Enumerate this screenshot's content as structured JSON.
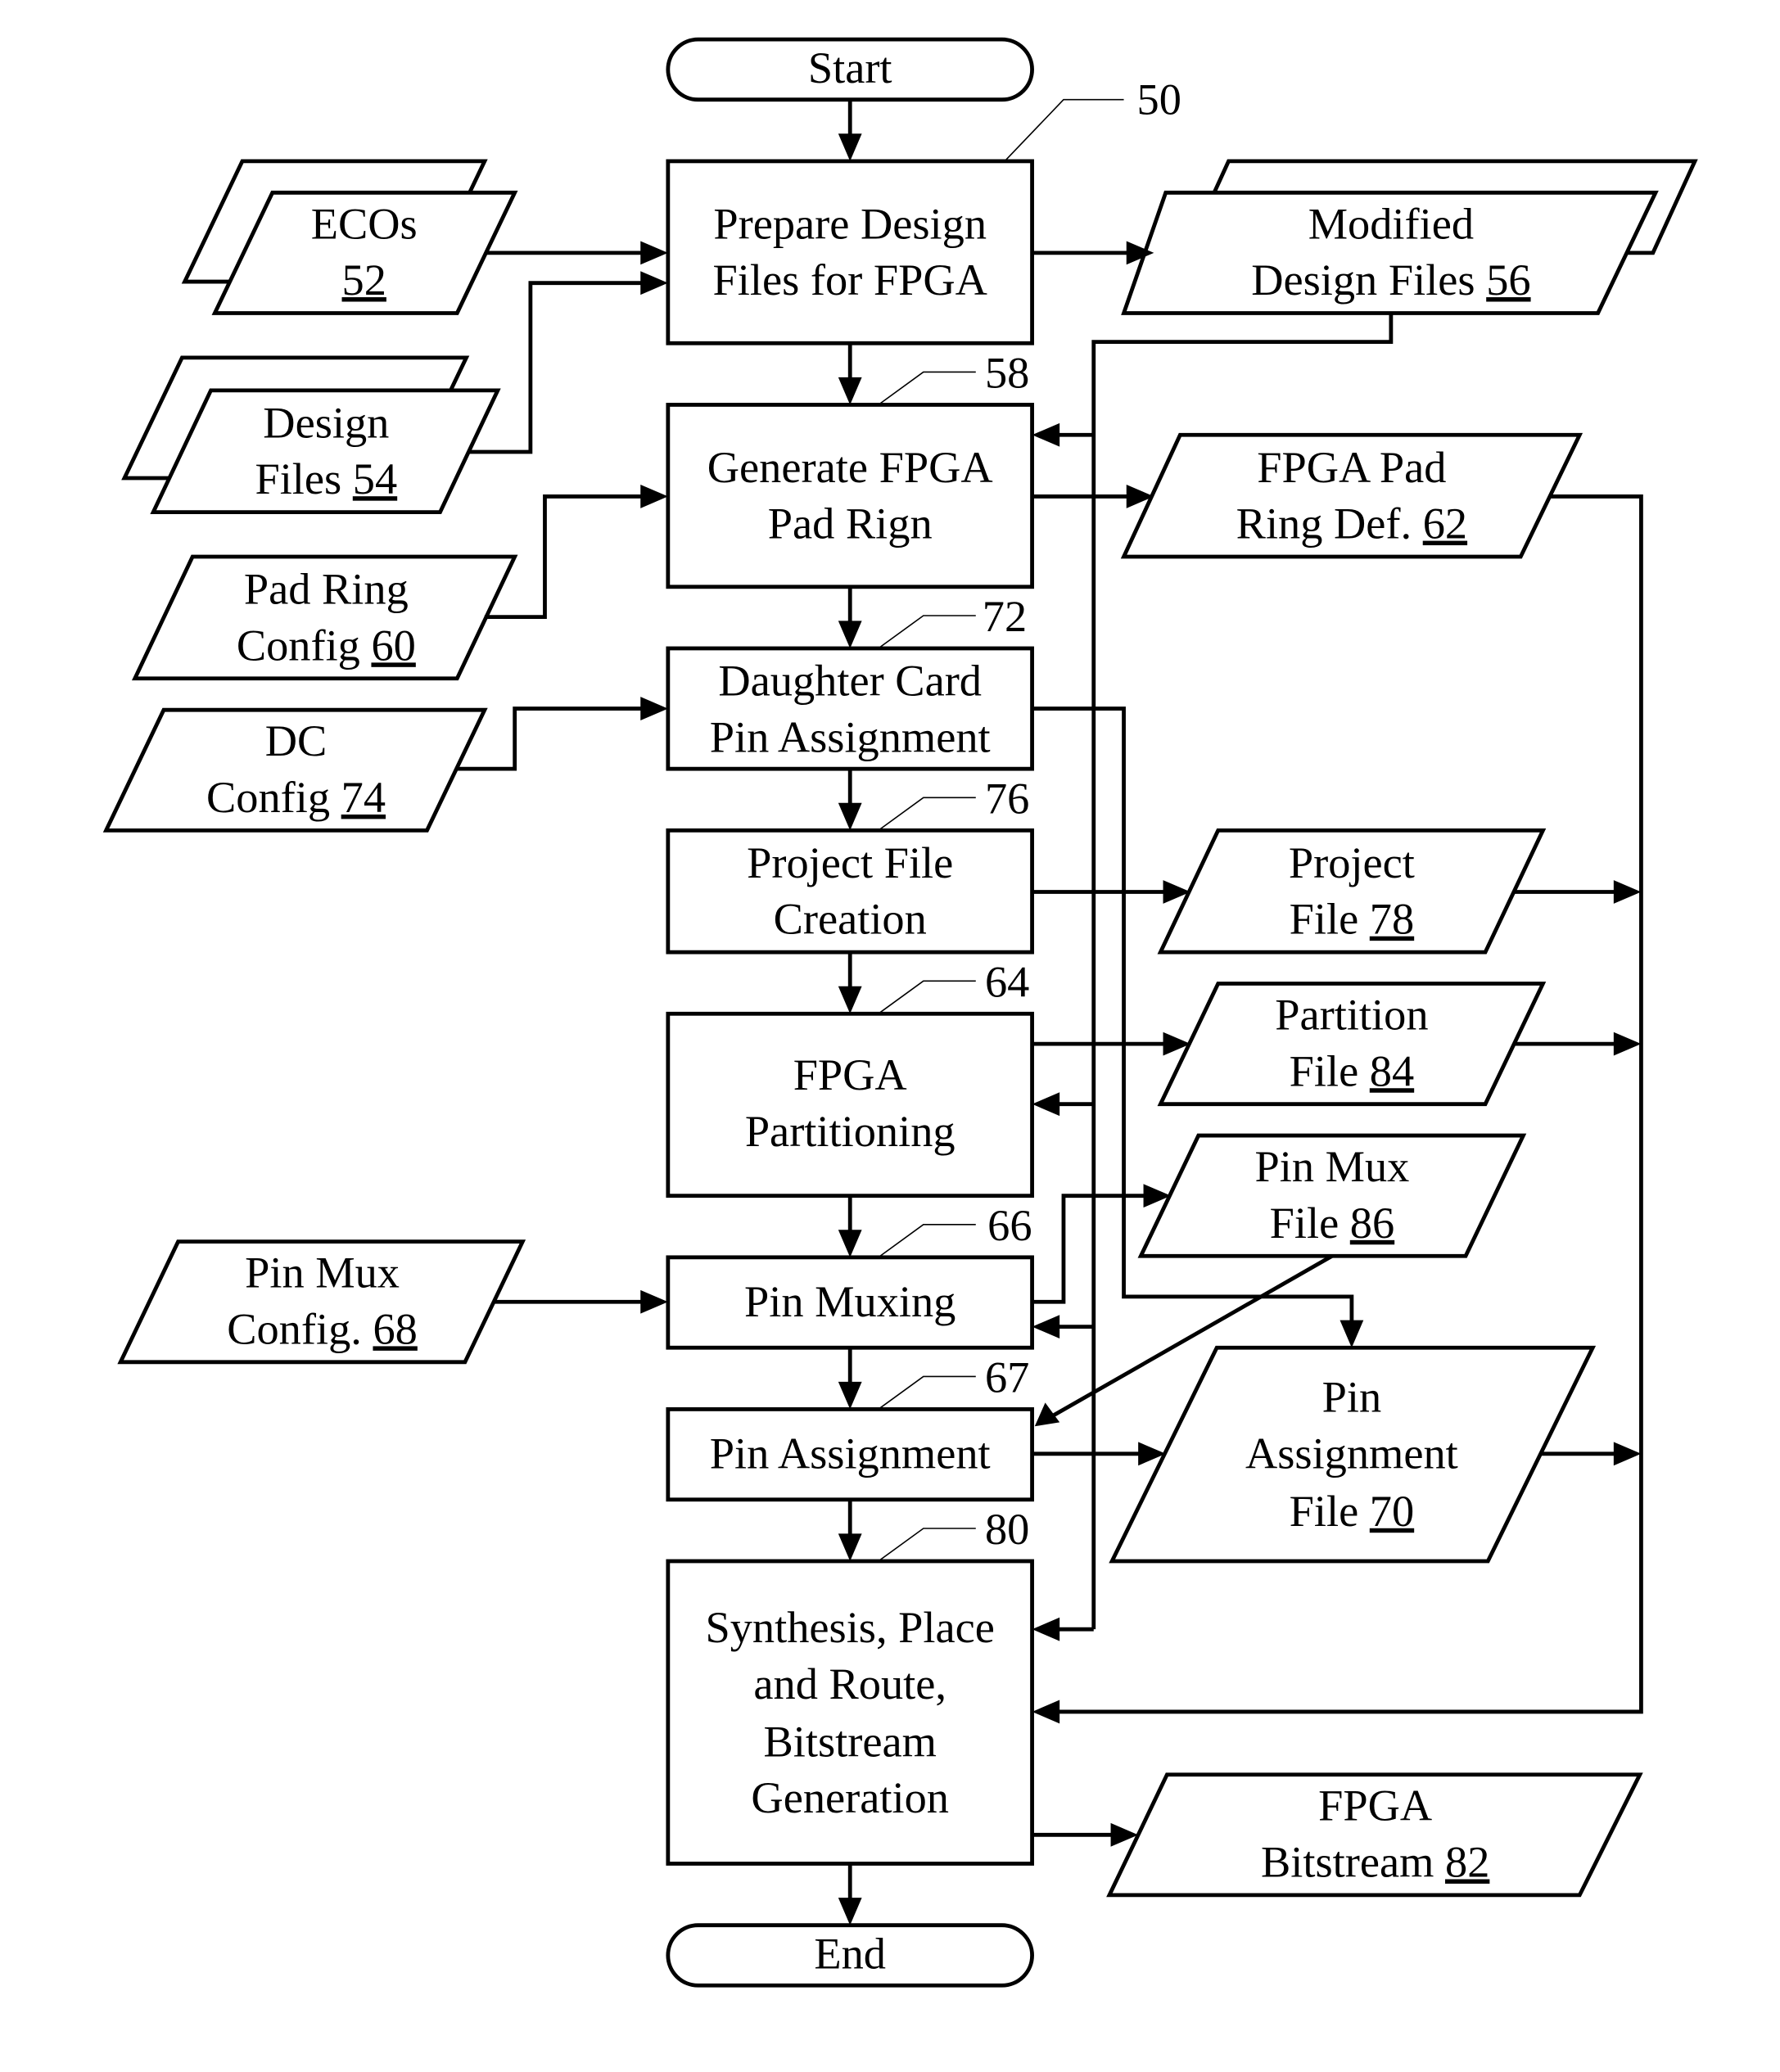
{
  "figure": {
    "ref_label": "50",
    "terminals": {
      "start": "Start",
      "end": "End"
    },
    "processes": [
      {
        "id": "prepare",
        "ref": "",
        "lines": [
          "Prepare Design",
          "Files for FPGA"
        ]
      },
      {
        "id": "padring",
        "ref": "58",
        "lines": [
          "Generate FPGA",
          "Pad Rign"
        ]
      },
      {
        "id": "dcpin",
        "ref": "72",
        "lines": [
          "Daughter Card",
          "Pin Assignment"
        ]
      },
      {
        "id": "project",
        "ref": "76",
        "lines": [
          "Project File",
          "Creation"
        ]
      },
      {
        "id": "partition",
        "ref": "64",
        "lines": [
          "FPGA",
          "Partitioning"
        ]
      },
      {
        "id": "pinmux",
        "ref": "66",
        "lines": [
          "Pin Muxing"
        ]
      },
      {
        "id": "pinassign",
        "ref": "67",
        "lines": [
          "Pin Assignment"
        ]
      },
      {
        "id": "synth",
        "ref": "80",
        "lines": [
          "Synthesis, Place",
          "and Route,",
          "Bitstream",
          "Generation"
        ]
      }
    ],
    "inputs": [
      {
        "id": "ecos",
        "lines": [
          "ECOs",
          ""
        ],
        "num": "52"
      },
      {
        "id": "design",
        "lines": [
          "Design",
          "Files "
        ],
        "num": "54"
      },
      {
        "id": "padcfg",
        "lines": [
          "Pad Ring",
          "Config "
        ],
        "num": "60"
      },
      {
        "id": "dccfg",
        "lines": [
          "DC",
          "Config "
        ],
        "num": "74"
      },
      {
        "id": "muxcfg",
        "lines": [
          "Pin Mux",
          "Config. "
        ],
        "num": "68"
      }
    ],
    "outputs": [
      {
        "id": "modified",
        "lines": [
          "Modified",
          "Design Files "
        ],
        "num": "56"
      },
      {
        "id": "paddef",
        "lines": [
          "FPGA Pad",
          "Ring Def. "
        ],
        "num": "62"
      },
      {
        "id": "projfile",
        "lines": [
          "Project",
          "File "
        ],
        "num": "78"
      },
      {
        "id": "partfile",
        "lines": [
          "Partition",
          "File "
        ],
        "num": "84"
      },
      {
        "id": "muxfile",
        "lines": [
          "Pin Mux",
          "File "
        ],
        "num": "86"
      },
      {
        "id": "assignfile",
        "lines": [
          "Pin",
          "Assignment",
          "File "
        ],
        "num": "70"
      },
      {
        "id": "bitstream",
        "lines": [
          "FPGA",
          "Bitstream "
        ],
        "num": "82"
      }
    ]
  }
}
